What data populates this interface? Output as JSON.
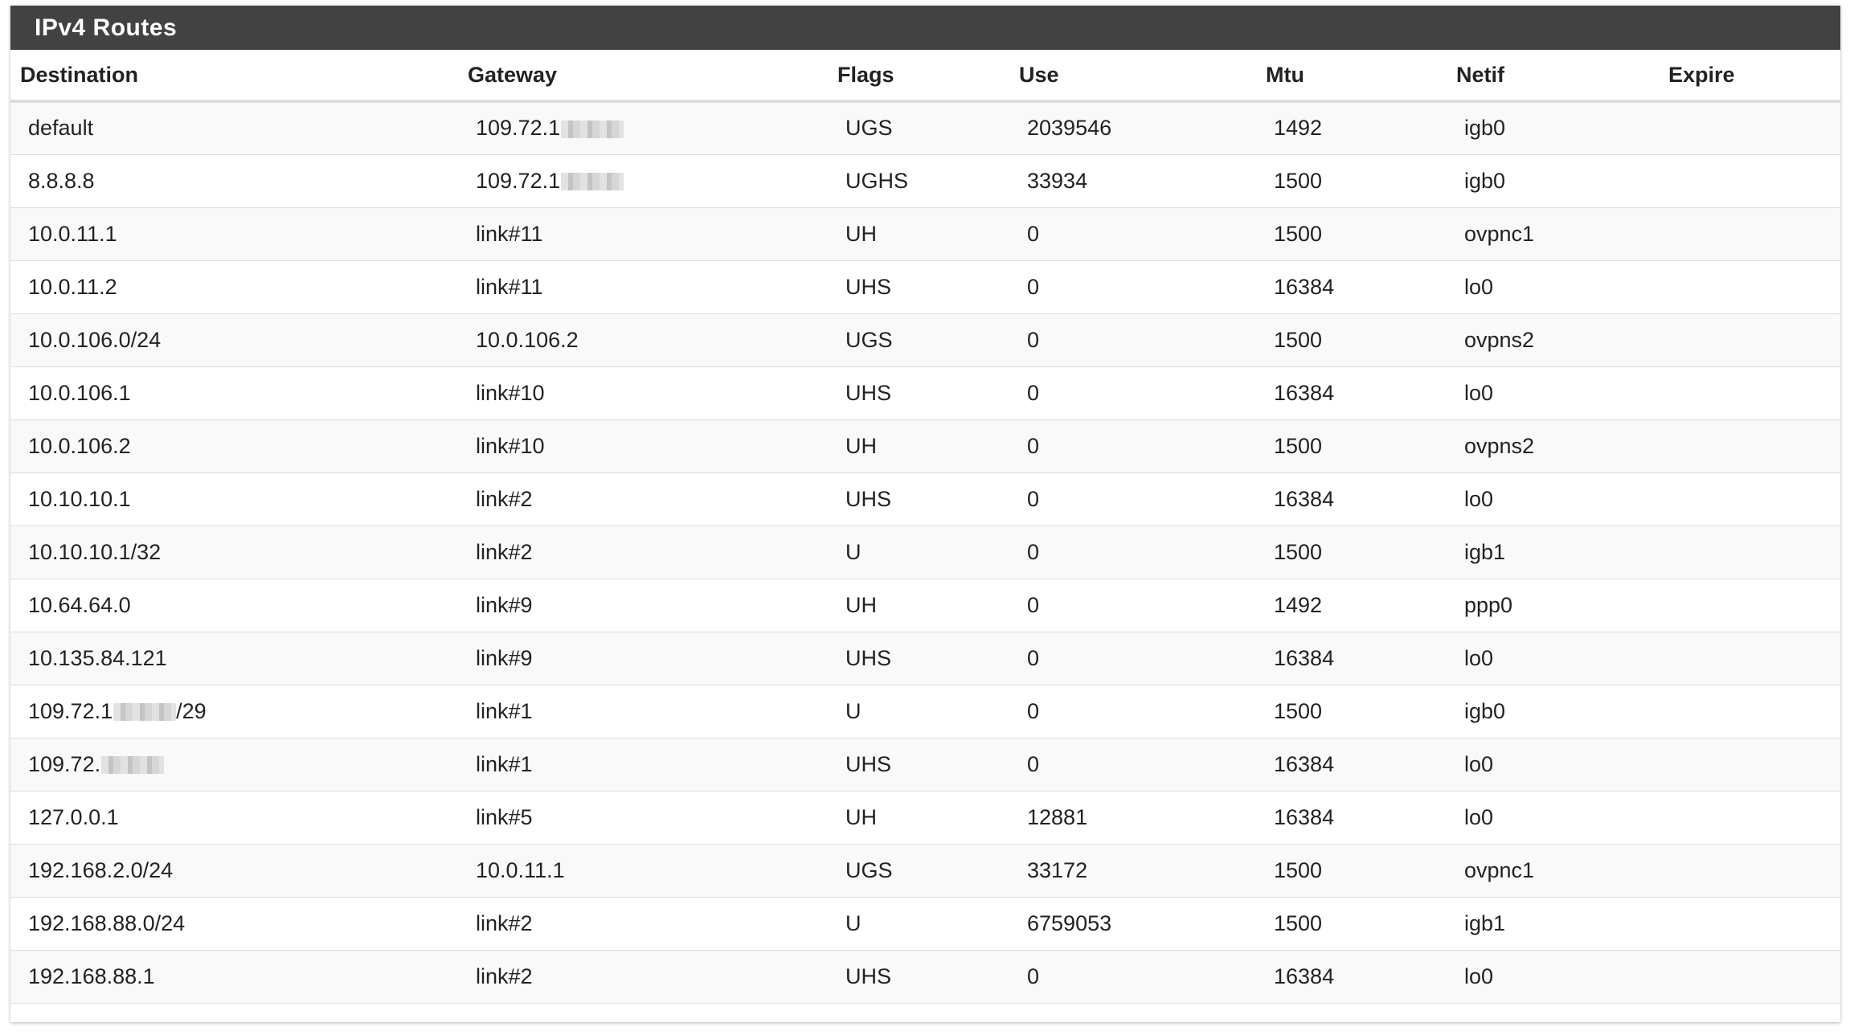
{
  "panel": {
    "title": "IPv4 Routes"
  },
  "table": {
    "columns": [
      "Destination",
      "Gateway",
      "Flags",
      "Use",
      "Mtu",
      "Netif",
      "Expire"
    ],
    "rows": [
      {
        "destination": "default",
        "dest_suffix": "",
        "dest_redacted": false,
        "gateway": "109.72.1",
        "gw_redacted": true,
        "flags": "UGS",
        "use": "2039546",
        "mtu": "1492",
        "netif": "igb0",
        "expire": ""
      },
      {
        "destination": "8.8.8.8",
        "dest_suffix": "",
        "dest_redacted": false,
        "gateway": "109.72.1",
        "gw_redacted": true,
        "flags": "UGHS",
        "use": "33934",
        "mtu": "1500",
        "netif": "igb0",
        "expire": ""
      },
      {
        "destination": "10.0.11.1",
        "dest_suffix": "",
        "dest_redacted": false,
        "gateway": "link#11",
        "gw_redacted": false,
        "flags": "UH",
        "use": "0",
        "mtu": "1500",
        "netif": "ovpnc1",
        "expire": ""
      },
      {
        "destination": "10.0.11.2",
        "dest_suffix": "",
        "dest_redacted": false,
        "gateway": "link#11",
        "gw_redacted": false,
        "flags": "UHS",
        "use": "0",
        "mtu": "16384",
        "netif": "lo0",
        "expire": ""
      },
      {
        "destination": "10.0.106.0/24",
        "dest_suffix": "",
        "dest_redacted": false,
        "gateway": "10.0.106.2",
        "gw_redacted": false,
        "flags": "UGS",
        "use": "0",
        "mtu": "1500",
        "netif": "ovpns2",
        "expire": ""
      },
      {
        "destination": "10.0.106.1",
        "dest_suffix": "",
        "dest_redacted": false,
        "gateway": "link#10",
        "gw_redacted": false,
        "flags": "UHS",
        "use": "0",
        "mtu": "16384",
        "netif": "lo0",
        "expire": ""
      },
      {
        "destination": "10.0.106.2",
        "dest_suffix": "",
        "dest_redacted": false,
        "gateway": "link#10",
        "gw_redacted": false,
        "flags": "UH",
        "use": "0",
        "mtu": "1500",
        "netif": "ovpns2",
        "expire": ""
      },
      {
        "destination": "10.10.10.1",
        "dest_suffix": "",
        "dest_redacted": false,
        "gateway": "link#2",
        "gw_redacted": false,
        "flags": "UHS",
        "use": "0",
        "mtu": "16384",
        "netif": "lo0",
        "expire": ""
      },
      {
        "destination": "10.10.10.1/32",
        "dest_suffix": "",
        "dest_redacted": false,
        "gateway": "link#2",
        "gw_redacted": false,
        "flags": "U",
        "use": "0",
        "mtu": "1500",
        "netif": "igb1",
        "expire": ""
      },
      {
        "destination": "10.64.64.0",
        "dest_suffix": "",
        "dest_redacted": false,
        "gateway": "link#9",
        "gw_redacted": false,
        "flags": "UH",
        "use": "0",
        "mtu": "1492",
        "netif": "ppp0",
        "expire": ""
      },
      {
        "destination": "10.135.84.121",
        "dest_suffix": "",
        "dest_redacted": false,
        "gateway": "link#9",
        "gw_redacted": false,
        "flags": "UHS",
        "use": "0",
        "mtu": "16384",
        "netif": "lo0",
        "expire": ""
      },
      {
        "destination": "109.72.1",
        "dest_suffix": "/29",
        "dest_redacted": true,
        "gateway": "link#1",
        "gw_redacted": false,
        "flags": "U",
        "use": "0",
        "mtu": "1500",
        "netif": "igb0",
        "expire": ""
      },
      {
        "destination": "109.72.",
        "dest_suffix": "",
        "dest_redacted": true,
        "gateway": "link#1",
        "gw_redacted": false,
        "flags": "UHS",
        "use": "0",
        "mtu": "16384",
        "netif": "lo0",
        "expire": ""
      },
      {
        "destination": "127.0.0.1",
        "dest_suffix": "",
        "dest_redacted": false,
        "gateway": "link#5",
        "gw_redacted": false,
        "flags": "UH",
        "use": "12881",
        "mtu": "16384",
        "netif": "lo0",
        "expire": ""
      },
      {
        "destination": "192.168.2.0/24",
        "dest_suffix": "",
        "dest_redacted": false,
        "gateway": "10.0.11.1",
        "gw_redacted": false,
        "flags": "UGS",
        "use": "33172",
        "mtu": "1500",
        "netif": "ovpnc1",
        "expire": ""
      },
      {
        "destination": "192.168.88.0/24",
        "dest_suffix": "",
        "dest_redacted": false,
        "gateway": "link#2",
        "gw_redacted": false,
        "flags": "U",
        "use": "6759053",
        "mtu": "1500",
        "netif": "igb1",
        "expire": ""
      },
      {
        "destination": "192.168.88.1",
        "dest_suffix": "",
        "dest_redacted": false,
        "gateway": "link#2",
        "gw_redacted": false,
        "flags": "UHS",
        "use": "0",
        "mtu": "16384",
        "netif": "lo0",
        "expire": ""
      }
    ]
  }
}
